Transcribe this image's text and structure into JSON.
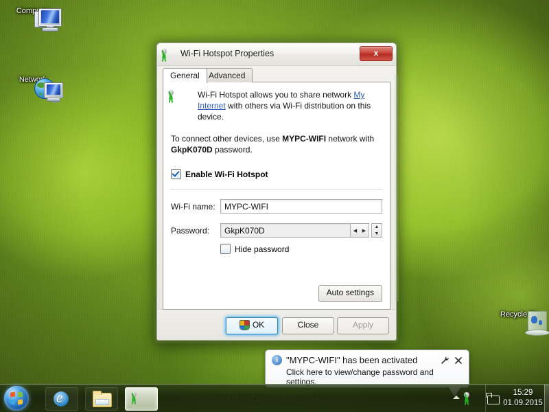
{
  "desktop": {
    "icons": [
      {
        "label": "Computer",
        "icon": "computer-icon"
      },
      {
        "label": "Network",
        "icon": "network-icon"
      },
      {
        "label": "Recycle Bin",
        "icon": "recycle-bin-icon"
      }
    ],
    "watermark": "GearDownload.com"
  },
  "dialog": {
    "title": "Wi-Fi Hotspot Properties",
    "title_icon": "wifi-hotspot-icon",
    "close_label": "x",
    "tabs": [
      {
        "label": "General",
        "active": true
      },
      {
        "label": "Advanced",
        "active": false
      }
    ],
    "general": {
      "info_icon": "wifi-antenna-icon",
      "info_text_1": "Wi-Fi Hotspot allows you to share network ",
      "info_link": "My Internet",
      "info_text_2": " with others via Wi-Fi distribution on this device.",
      "connect_text_1": "To connect other devices, use ",
      "connect_network": "MYPC-WIFI",
      "connect_text_2": " network with ",
      "connect_password": "GkpK070D",
      "connect_text_3": " password.",
      "enable_checkbox_label": "Enable Wi-Fi Hotspot",
      "enable_checkbox_checked": "true",
      "wifi_name_label": "Wi-Fi name:",
      "wifi_name_value": "MYPC-WIFI",
      "password_label": "Password:",
      "password_value": "GkpK070D",
      "hide_password_label": "Hide password",
      "hide_password_checked": "false",
      "auto_settings_label": "Auto settings"
    }
  },
  "footer": {
    "ok_label": "OK",
    "close_label": "Close",
    "apply_label": "Apply",
    "ok_icon": "uac-shield-icon"
  },
  "balloon": {
    "info_icon": "info-icon",
    "title": "\"MYPC-WIFI\" has been activated",
    "subtitle": "Click here to view/change password and settings.",
    "pin_icon": "wrench-icon",
    "close_icon": "close-icon"
  },
  "taskbar": {
    "start_label": "Start",
    "buttons": [
      {
        "name": "internet-explorer",
        "icon": "internet-explorer-icon"
      },
      {
        "name": "windows-explorer",
        "icon": "folder-icon"
      },
      {
        "name": "wifi-hotspot",
        "icon": "wifi-antenna-icon",
        "active": true
      }
    ],
    "tray": {
      "show_hidden_icon": "chevron-up-icon",
      "wifi_icon": "wifi-antenna-icon",
      "network_icon": "network-monitor-icon"
    },
    "clock": {
      "time": "15:29",
      "date": "01.09.2015"
    }
  },
  "colors": {
    "accent_blue": "#2a5db0",
    "wifi_green": "#27b024",
    "close_red": "#c9453a",
    "desktop_green": "#6f9622"
  }
}
